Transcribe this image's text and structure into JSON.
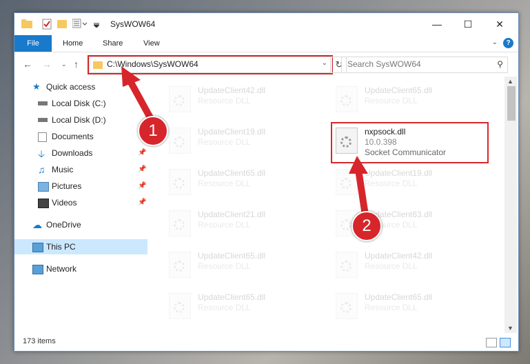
{
  "window": {
    "title": "SysWOW64",
    "controls": {
      "minimize": "—",
      "maximize": "☐",
      "close": "✕"
    }
  },
  "ribbon": {
    "tabs": [
      "File",
      "Home",
      "Share",
      "View"
    ],
    "help": "?"
  },
  "address": {
    "path": "C:\\Windows\\SysWOW64",
    "search_placeholder": "Search SysWOW64"
  },
  "sidebar": {
    "items": [
      {
        "label": "Quick access",
        "icon": "star-icon"
      },
      {
        "label": "Local Disk (C:)",
        "icon": "drive-icon"
      },
      {
        "label": "Local Disk (D:)",
        "icon": "drive-icon"
      },
      {
        "label": "Documents",
        "icon": "documents-icon"
      },
      {
        "label": "Downloads",
        "icon": "download-icon"
      },
      {
        "label": "Music",
        "icon": "music-icon"
      },
      {
        "label": "Pictures",
        "icon": "pictures-icon"
      },
      {
        "label": "Videos",
        "icon": "videos-icon"
      },
      {
        "label": "OneDrive",
        "icon": "cloud-icon"
      },
      {
        "label": "This PC",
        "icon": "monitor-icon"
      },
      {
        "label": "Network",
        "icon": "network-icon"
      }
    ]
  },
  "files": {
    "left": [
      {
        "name": "UpdateClient42.dll",
        "type": "Resource DLL"
      },
      {
        "name": "UpdateClient19.dll",
        "type": "Resource DLL"
      },
      {
        "name": "UpdateClient65.dll",
        "type": "Resource DLL"
      },
      {
        "name": "UpdateClient21.dll",
        "type": "Resource DLL"
      },
      {
        "name": "UpdateClient65.dll",
        "type": "Resource DLL"
      },
      {
        "name": "UpdateClient65.dll",
        "type": "Resource DLL"
      }
    ],
    "right": [
      {
        "name": "UpdateClient65.dll",
        "type": "Resource DLL"
      },
      {
        "name": "nxpsock.dll",
        "version": "10.0.398",
        "description": "Socket Communicator"
      },
      {
        "name": "UpdateClient19.dll",
        "type": "Resource DLL"
      },
      {
        "name": "UpdateClient63.dll",
        "type": "Resource DLL"
      },
      {
        "name": "UpdateClient42.dll",
        "type": "Resource DLL"
      },
      {
        "name": "UpdateClient65.dll",
        "type": "Resource DLL"
      }
    ]
  },
  "status": {
    "items_count": "173 items"
  },
  "annotations": {
    "callout_1": "1",
    "callout_2": "2"
  },
  "colors": {
    "accent": "#1979ca",
    "highlight": "#d6262b",
    "selection": "#cce8ff"
  }
}
